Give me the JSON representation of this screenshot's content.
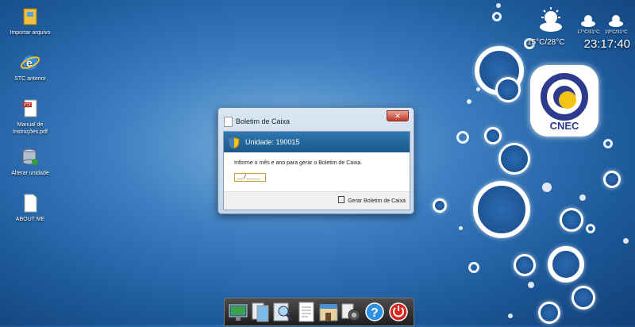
{
  "desktop": {
    "icons": [
      {
        "name": "import-icon",
        "label": "Importar arquivo"
      },
      {
        "name": "ie-icon",
        "label": "STC anterior"
      },
      {
        "name": "pdf-icon",
        "label": "Manual de Instruções.pdf"
      },
      {
        "name": "database-icon",
        "label": "Alterar unidade"
      },
      {
        "name": "file-icon",
        "label": "ABOUT ME"
      }
    ]
  },
  "weather": {
    "main_temp": "15°C/28°C",
    "small1_temp": "17°C/31°C",
    "small2_temp": "19°C/31°C",
    "time": "23:17:40"
  },
  "logo": {
    "text": "CNEC"
  },
  "dialog": {
    "title": "Boletim de Caixa",
    "close": "✕",
    "unit": "Unidade: 190015",
    "info": "Informe o mês e ano para gerar o Boletim de Caixa.",
    "date_value": "__/____",
    "button": "Gerar Boletim de Caixa"
  },
  "dock": {
    "items": [
      "monitor-icon",
      "files-icon",
      "search-icon",
      "document-icon",
      "store-icon",
      "settings-icon",
      "help-icon",
      "power-icon"
    ]
  },
  "colors": {
    "accent": "#1a5889",
    "close": "#c1392b",
    "dock": "#1d1d1d"
  }
}
